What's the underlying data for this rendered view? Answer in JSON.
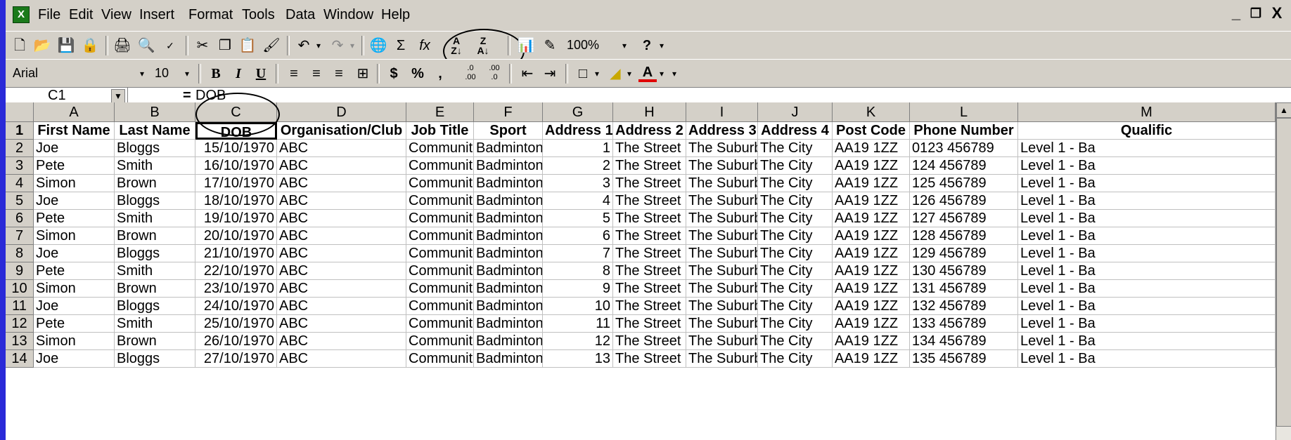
{
  "menu": [
    "File",
    "Edit",
    "View",
    "Insert",
    "Format",
    "Tools",
    "Data",
    "Window",
    "Help"
  ],
  "window_controls": [
    "_",
    " ❐",
    "X"
  ],
  "toolbar": {
    "zoom": "100%",
    "font_name": "Arial",
    "font_size": "10",
    "bold": "B",
    "italic": "I",
    "underline": "U",
    "currency": "$",
    "percent": "%",
    "comma": ","
  },
  "formula_bar": {
    "name_box": "C1",
    "equals": "=",
    "value": "DOB"
  },
  "columns": [
    "A",
    "B",
    "C",
    "D",
    "E",
    "F",
    "G",
    "H",
    "I",
    "J",
    "K",
    "L",
    "M"
  ],
  "headers": [
    "First Name",
    "Last Name",
    "DOB",
    "Organisation/Club",
    "Job Title",
    "Sport",
    "Address 1",
    "Address 2",
    "Address 3",
    "Address 4",
    "Post Code",
    "Phone Number",
    "Qualific"
  ],
  "rows": [
    {
      "n": "2",
      "c": [
        "Joe",
        "Bloggs",
        "15/10/1970",
        "ABC",
        "Communit",
        "Badminton",
        "1",
        "The Street",
        "The Suburb",
        "The City",
        "AA19 1ZZ",
        "0123 456789",
        "Level 1 - Ba"
      ]
    },
    {
      "n": "3",
      "c": [
        "Pete",
        "Smith",
        "16/10/1970",
        "ABC",
        "Communit",
        "Badminton",
        "2",
        "The Street",
        "The Suburb",
        "The City",
        "AA19 1ZZ",
        "124 456789",
        "Level 1 - Ba"
      ]
    },
    {
      "n": "4",
      "c": [
        "Simon",
        "Brown",
        "17/10/1970",
        "ABC",
        "Communit",
        "Badminton",
        "3",
        "The Street",
        "The Suburb",
        "The City",
        "AA19 1ZZ",
        "125 456789",
        "Level 1 - Ba"
      ]
    },
    {
      "n": "5",
      "c": [
        "Joe",
        "Bloggs",
        "18/10/1970",
        "ABC",
        "Communit",
        "Badminton",
        "4",
        "The Street",
        "The Suburb",
        "The City",
        "AA19 1ZZ",
        "126 456789",
        "Level 1 - Ba"
      ]
    },
    {
      "n": "6",
      "c": [
        "Pete",
        "Smith",
        "19/10/1970",
        "ABC",
        "Communit",
        "Badminton",
        "5",
        "The Street",
        "The Suburb",
        "The City",
        "AA19 1ZZ",
        "127 456789",
        "Level 1 - Ba"
      ]
    },
    {
      "n": "7",
      "c": [
        "Simon",
        "Brown",
        "20/10/1970",
        "ABC",
        "Communit",
        "Badminton",
        "6",
        "The Street",
        "The Suburb",
        "The City",
        "AA19 1ZZ",
        "128 456789",
        "Level 1 - Ba"
      ]
    },
    {
      "n": "8",
      "c": [
        "Joe",
        "Bloggs",
        "21/10/1970",
        "ABC",
        "Communit",
        "Badminton",
        "7",
        "The Street",
        "The Suburb",
        "The City",
        "AA19 1ZZ",
        "129 456789",
        "Level 1 - Ba"
      ]
    },
    {
      "n": "9",
      "c": [
        "Pete",
        "Smith",
        "22/10/1970",
        "ABC",
        "Communit",
        "Badminton",
        "8",
        "The Street",
        "The Suburb",
        "The City",
        "AA19 1ZZ",
        "130 456789",
        "Level 1 - Ba"
      ]
    },
    {
      "n": "10",
      "c": [
        "Simon",
        "Brown",
        "23/10/1970",
        "ABC",
        "Communit",
        "Badminton",
        "9",
        "The Street",
        "The Suburb",
        "The City",
        "AA19 1ZZ",
        "131 456789",
        "Level 1 - Ba"
      ]
    },
    {
      "n": "11",
      "c": [
        "Joe",
        "Bloggs",
        "24/10/1970",
        "ABC",
        "Communit",
        "Badminton",
        "10",
        "The Street",
        "The Suburb",
        "The City",
        "AA19 1ZZ",
        "132 456789",
        "Level 1 - Ba"
      ]
    },
    {
      "n": "12",
      "c": [
        "Pete",
        "Smith",
        "25/10/1970",
        "ABC",
        "Communit",
        "Badminton",
        "11",
        "The Street",
        "The Suburb",
        "The City",
        "AA19 1ZZ",
        "133 456789",
        "Level 1 - Ba"
      ]
    },
    {
      "n": "13",
      "c": [
        "Simon",
        "Brown",
        "26/10/1970",
        "ABC",
        "Communit",
        "Badminton",
        "12",
        "The Street",
        "The Suburb",
        "The City",
        "AA19 1ZZ",
        "134 456789",
        "Level 1 - Ba"
      ]
    },
    {
      "n": "14",
      "c": [
        "Joe",
        "Bloggs",
        "27/10/1970",
        "ABC",
        "Communit",
        "Badminton",
        "13",
        "The Street",
        "The Suburb",
        "The City",
        "AA19 1ZZ",
        "135 456789",
        "Level 1 - Ba"
      ]
    }
  ],
  "header_row_number": "1",
  "colors": {
    "desktop": "#2a2ad8",
    "chrome": "#d4d0c8",
    "selection_border": "#000000"
  }
}
